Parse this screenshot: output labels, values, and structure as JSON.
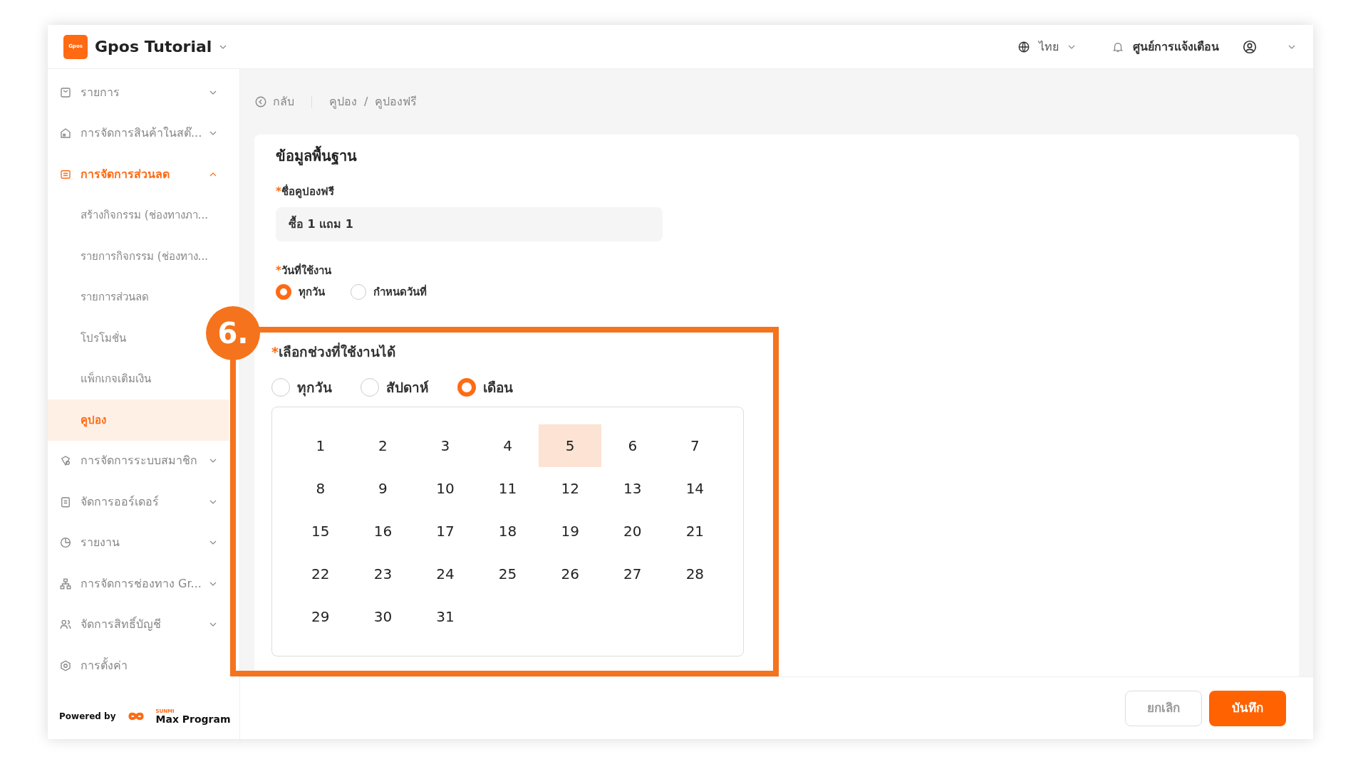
{
  "topbar": {
    "logo_text": "Gpos",
    "title": "Gpos Tutorial",
    "language": "ไทย",
    "notifications": "ศูนย์การแจ้งเตือน"
  },
  "sidebar": {
    "items": [
      {
        "label": "รายการ",
        "kind": "group",
        "expanded": false,
        "selected": false
      },
      {
        "label": "การจัดการสินค้าในสต๊...",
        "kind": "group",
        "expanded": false,
        "selected": false
      },
      {
        "label": "การจัดการส่วนลด",
        "kind": "group",
        "expanded": true,
        "selected": true,
        "children": [
          {
            "label": "สร้างกิจกรรม (ช่องทางภา...",
            "selected": false
          },
          {
            "label": "รายการกิจกรรม (ช่องทาง...",
            "selected": false
          },
          {
            "label": "รายการส่วนลด",
            "selected": false
          },
          {
            "label": "โปรโมชั่น",
            "selected": false
          },
          {
            "label": "แพ็กเกจเติมเงิน",
            "selected": false
          },
          {
            "label": "คูปอง",
            "selected": true
          }
        ]
      },
      {
        "label": "การจัดการระบบสมาชิก",
        "kind": "group",
        "expanded": false,
        "selected": false
      },
      {
        "label": "จัดการออร์เดอร์",
        "kind": "group",
        "expanded": false,
        "selected": false
      },
      {
        "label": "รายงาน",
        "kind": "group",
        "expanded": false,
        "selected": false
      },
      {
        "label": "การจัดการช่องทาง Gr...",
        "kind": "group",
        "expanded": false,
        "selected": false
      },
      {
        "label": "จัดการสิทธิ์บัญชี",
        "kind": "group",
        "expanded": false,
        "selected": false
      },
      {
        "label": "การตั้งค่า",
        "kind": "link",
        "selected": false
      }
    ],
    "powered_by": "Powered by",
    "brand_small": "SUNMI",
    "brand": "Max Program"
  },
  "breadcrumb": {
    "back": "กลับ",
    "items": [
      "คูปอง",
      "คูปองฟรี"
    ],
    "separator": "/"
  },
  "form": {
    "title": "ข้อมูลพื้นฐาน",
    "name_label": {
      "mark": "*",
      "text": "ชื่อคูปองฟรี"
    },
    "name_value": "ซื้อ 1 แถม 1",
    "date_label": {
      "mark": "*",
      "text": "วันที่ใช้งาน"
    },
    "date_options": [
      {
        "label": "ทุกวัน",
        "selected": true
      },
      {
        "label": "กำหนดวันที่",
        "selected": false
      }
    ],
    "period_label": {
      "mark": "*",
      "text": "เลือกช่วงที่ใช้งานได้"
    },
    "period_options": [
      {
        "label": "ทุกวัน",
        "selected": false
      },
      {
        "label": "สัปดาห์",
        "selected": false
      },
      {
        "label": "เดือน",
        "selected": true
      }
    ],
    "days": [
      {
        "label": "1",
        "selected": false
      },
      {
        "label": "2",
        "selected": false
      },
      {
        "label": "3",
        "selected": false
      },
      {
        "label": "4",
        "selected": false
      },
      {
        "label": "5",
        "selected": true
      },
      {
        "label": "6",
        "selected": false
      },
      {
        "label": "7",
        "selected": false
      },
      {
        "label": "8",
        "selected": false
      },
      {
        "label": "9",
        "selected": false
      },
      {
        "label": "10",
        "selected": false
      },
      {
        "label": "11",
        "selected": false
      },
      {
        "label": "12",
        "selected": false
      },
      {
        "label": "13",
        "selected": false
      },
      {
        "label": "14",
        "selected": false
      },
      {
        "label": "15",
        "selected": false
      },
      {
        "label": "16",
        "selected": false
      },
      {
        "label": "17",
        "selected": false
      },
      {
        "label": "18",
        "selected": false
      },
      {
        "label": "19",
        "selected": false
      },
      {
        "label": "20",
        "selected": false
      },
      {
        "label": "21",
        "selected": false
      },
      {
        "label": "22",
        "selected": false
      },
      {
        "label": "23",
        "selected": false
      },
      {
        "label": "24",
        "selected": false
      },
      {
        "label": "25",
        "selected": false
      },
      {
        "label": "26",
        "selected": false
      },
      {
        "label": "27",
        "selected": false
      },
      {
        "label": "28",
        "selected": false
      },
      {
        "label": "29",
        "selected": false
      },
      {
        "label": "30",
        "selected": false
      },
      {
        "label": "31",
        "selected": false
      }
    ]
  },
  "actions": {
    "cancel": "ยกเลิก",
    "save": "บันทึก"
  },
  "annotation": {
    "callout": "6."
  }
}
